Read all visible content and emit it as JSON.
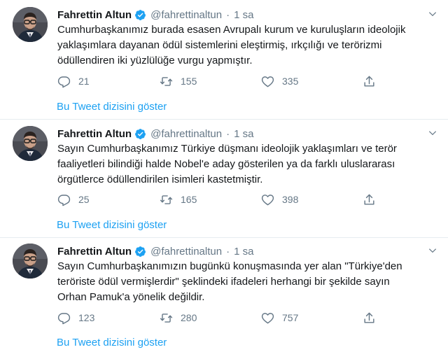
{
  "tweets": [
    {
      "name": "Fahrettin Altun",
      "handle": "@fahrettinaltun",
      "separator": "·",
      "time": "1 sa",
      "text": "Cumhurbaşkanımız burada esasen  Avrupalı kurum ve kuruluşların ideolojik\nyaklaşımlara dayanan ödül sistemlerini eleştirmiş, ırkçılığı ve terörizmi\nödüllendiren iki yüzlülüğe vurgu yapmıştır.",
      "replies": "21",
      "retweets": "155",
      "likes": "335",
      "show_thread": "Bu Tweet dizisini göster"
    },
    {
      "name": "Fahrettin Altun",
      "handle": "@fahrettinaltun",
      "separator": "·",
      "time": "1 sa",
      "text": "Sayın Cumhurbaşkanımız Türkiye düşmanı ideolojik yaklaşımları ve terör\nfaaliyetleri bilindiği halde Nobel'e aday gösterilen ya da farklı uluslararası\nörgütlerce ödüllendirilen isimleri kastetmiştir.",
      "replies": "25",
      "retweets": "165",
      "likes": "398",
      "show_thread": "Bu Tweet dizisini göster"
    },
    {
      "name": "Fahrettin Altun",
      "handle": "@fahrettinaltun",
      "separator": "·",
      "time": "1 sa",
      "text": "Sayın Cumhurbaşkanımızın bugünkü konuşmasında yer alan \"Türkiye'den\nteröriste ödül vermişlerdir\" şeklindeki  ifadeleri herhangi bir şekilde sayın\nOrhan Pamuk'a yönelik değildir.",
      "replies": "123",
      "retweets": "280",
      "likes": "757",
      "show_thread": "Bu Tweet dizisini göster"
    }
  ],
  "colors": {
    "accent": "#1da1f2",
    "muted": "#657786",
    "text": "#14171a",
    "border": "#e6ecf0"
  },
  "icons": [
    "verified-badge-icon",
    "chevron-down-icon",
    "reply-icon",
    "retweet-icon",
    "like-icon",
    "share-icon"
  ]
}
